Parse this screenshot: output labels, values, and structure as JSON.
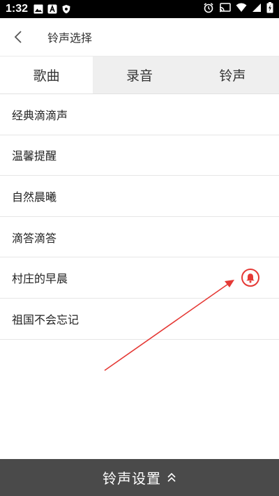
{
  "status_bar": {
    "time": "1:32"
  },
  "header": {
    "title": "铃声选择"
  },
  "tabs": [
    {
      "label": "歌曲",
      "active": true
    },
    {
      "label": "录音",
      "active": false
    },
    {
      "label": "铃声",
      "active": false
    }
  ],
  "songs": [
    {
      "label": "经典滴滴声"
    },
    {
      "label": "温馨提醒"
    },
    {
      "label": "自然晨曦"
    },
    {
      "label": "滴答滴答"
    },
    {
      "label": "村庄的早晨",
      "selected": true,
      "icon": "bell-icon"
    },
    {
      "label": "祖国不会忘记"
    }
  ],
  "bottom_bar": {
    "label": "铃声设置",
    "icon": "double-chevron-up-icon"
  },
  "colors": {
    "accent": "#e53935",
    "bottom_bar": "#4a4a4a",
    "tab_inactive_bg": "#efefef"
  }
}
